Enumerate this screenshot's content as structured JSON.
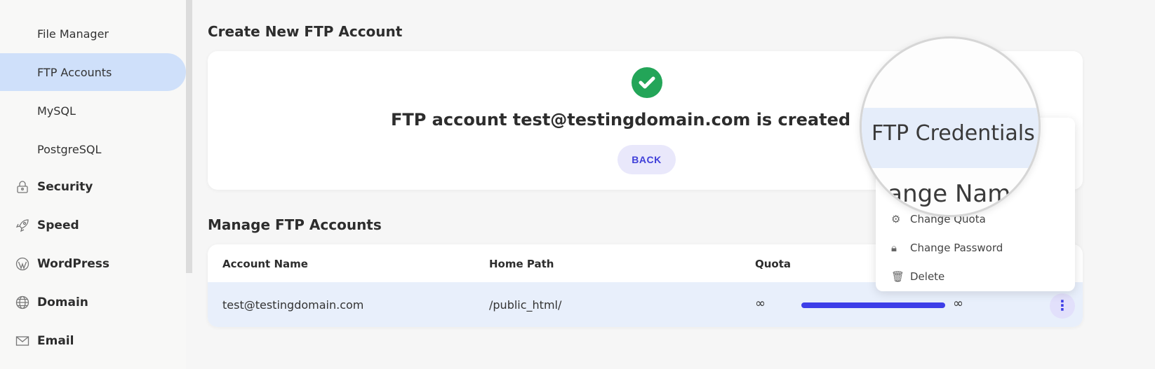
{
  "sidebar": {
    "items": [
      {
        "label": "File Manager"
      },
      {
        "label": "FTP Accounts",
        "active": true
      },
      {
        "label": "MySQL"
      },
      {
        "label": "PostgreSQL"
      },
      {
        "label": "Security",
        "icon": "lock-icon"
      },
      {
        "label": "Speed",
        "icon": "rocket-icon"
      },
      {
        "label": "WordPress",
        "icon": "wordpress-icon"
      },
      {
        "label": "Domain",
        "icon": "globe-icon"
      },
      {
        "label": "Email",
        "icon": "envelope-icon"
      }
    ]
  },
  "create": {
    "title": "Create New FTP Account",
    "message": "FTP account test@testingdomain.com is created",
    "back_label": "BACK"
  },
  "manage": {
    "title": "Manage FTP Accounts",
    "columns": [
      "Account Name",
      "Home Path",
      "Quota"
    ],
    "rows": [
      {
        "account": "test@testingdomain.com",
        "path": "/public_html/",
        "quota_used": "∞",
        "quota_total": "∞",
        "quota_percent": 100
      }
    ]
  },
  "menu": {
    "items": [
      {
        "label": "FTP Credentials",
        "highlighted": true
      },
      {
        "label": "Change Name"
      },
      {
        "label": "Change Quota",
        "icon": "gear-icon"
      },
      {
        "label": "Change Password",
        "icon": "lock-icon"
      },
      {
        "label": "Delete",
        "icon": "trash-icon"
      }
    ]
  },
  "colors": {
    "accent": "#3d3ee8",
    "success": "#23a558",
    "active_bg": "#cfe0fa"
  }
}
